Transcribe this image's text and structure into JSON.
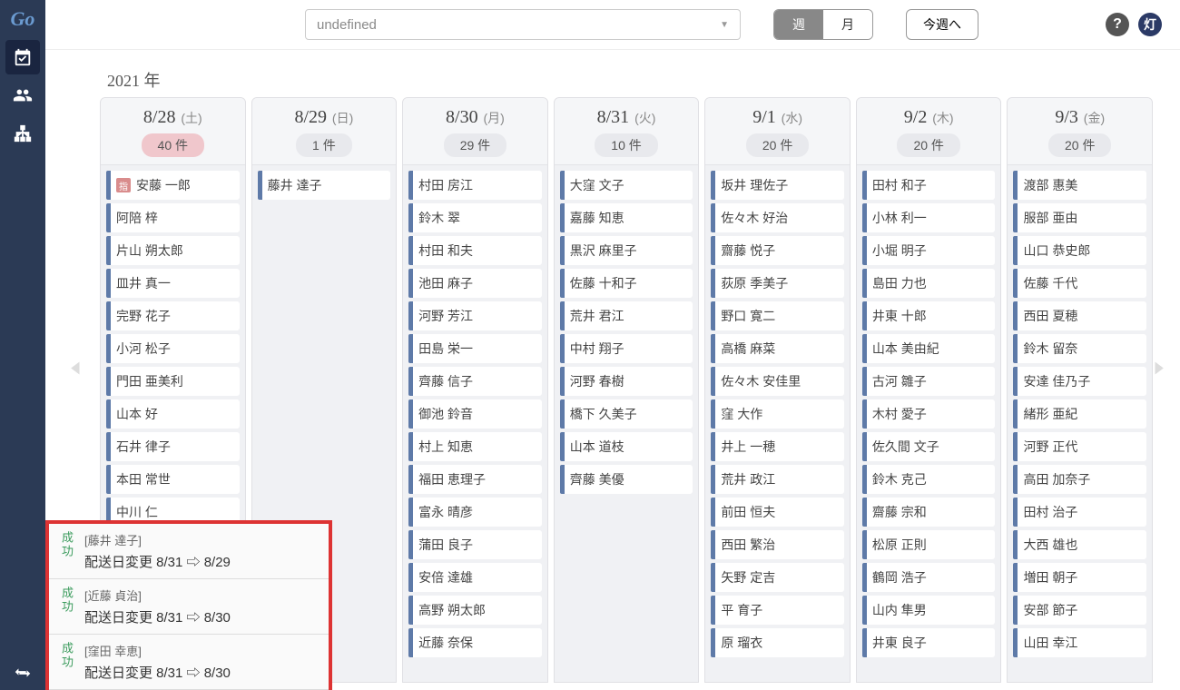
{
  "brand": {
    "logo": "Go",
    "circle": "灯"
  },
  "topbar": {
    "dropdown_value": "undefined",
    "toggle_week": "週",
    "toggle_month": "月",
    "today_btn": "今週へ",
    "help": "?"
  },
  "year_label": "2021 年",
  "days": [
    {
      "date": "8/28",
      "dow": "(土)",
      "count": "40 件",
      "highlight": true,
      "entries": [
        {
          "name": "安藤 一郎",
          "badge": "指"
        },
        {
          "name": "阿陪 梓"
        },
        {
          "name": "片山 朔太郎"
        },
        {
          "name": "皿井 真一"
        },
        {
          "name": "完野 花子"
        },
        {
          "name": "小河 松子"
        },
        {
          "name": "門田 亜美利"
        },
        {
          "name": "山本 好"
        },
        {
          "name": "石井 律子"
        },
        {
          "name": "本田 常世"
        },
        {
          "name": "中川 仁"
        }
      ]
    },
    {
      "date": "8/29",
      "dow": "(日)",
      "count": "1 件",
      "entries": [
        {
          "name": "藤井 達子"
        }
      ]
    },
    {
      "date": "8/30",
      "dow": "(月)",
      "count": "29 件",
      "entries": [
        {
          "name": "村田 房江"
        },
        {
          "name": "鈴木 翠"
        },
        {
          "name": "村田 和夫"
        },
        {
          "name": "池田 麻子"
        },
        {
          "name": "河野 芳江"
        },
        {
          "name": "田島 栄一"
        },
        {
          "name": "齊藤 信子"
        },
        {
          "name": "御池 鈴音"
        },
        {
          "name": "村上 知恵"
        },
        {
          "name": "福田 恵理子"
        },
        {
          "name": "富永 晴彦"
        },
        {
          "name": "蒲田 良子"
        },
        {
          "name": "安倍 達雄"
        },
        {
          "name": "高野 朔太郎"
        },
        {
          "name": "近藤 奈保"
        }
      ]
    },
    {
      "date": "8/31",
      "dow": "(火)",
      "count": "10 件",
      "entries": [
        {
          "name": "大窪 文子"
        },
        {
          "name": "嘉藤 知恵"
        },
        {
          "name": "黒沢 麻里子"
        },
        {
          "name": "佐藤 十和子"
        },
        {
          "name": "荒井 君江"
        },
        {
          "name": "中村 翔子"
        },
        {
          "name": "河野 春樹"
        },
        {
          "name": "橋下 久美子"
        },
        {
          "name": "山本 道枝"
        },
        {
          "name": "齊藤 美優"
        }
      ]
    },
    {
      "date": "9/1",
      "dow": "(水)",
      "count": "20 件",
      "entries": [
        {
          "name": "坂井 理佐子"
        },
        {
          "name": "佐々木 好治"
        },
        {
          "name": "齋藤 悦子"
        },
        {
          "name": "荻原 季美子"
        },
        {
          "name": "野口 寛二"
        },
        {
          "name": "高橋 麻菜"
        },
        {
          "name": "佐々木 安佳里"
        },
        {
          "name": "窪 大作"
        },
        {
          "name": "井上 一穂"
        },
        {
          "name": "荒井 政江"
        },
        {
          "name": "前田 恒夫"
        },
        {
          "name": "西田 繁治"
        },
        {
          "name": "矢野 定吉"
        },
        {
          "name": "平 育子"
        },
        {
          "name": "原 瑠衣"
        }
      ]
    },
    {
      "date": "9/2",
      "dow": "(木)",
      "count": "20 件",
      "entries": [
        {
          "name": "田村 和子"
        },
        {
          "name": "小林 利一"
        },
        {
          "name": "小堀 明子"
        },
        {
          "name": "島田 力也"
        },
        {
          "name": "井東 十郎"
        },
        {
          "name": "山本 美由紀"
        },
        {
          "name": "古河 雛子"
        },
        {
          "name": "木村 愛子"
        },
        {
          "name": "佐久間 文子"
        },
        {
          "name": "鈴木 克己"
        },
        {
          "name": "齋藤 宗和"
        },
        {
          "name": "松原 正則"
        },
        {
          "name": "鶴岡 浩子"
        },
        {
          "name": "山内 隼男"
        },
        {
          "name": "井東 良子"
        }
      ]
    },
    {
      "date": "9/3",
      "dow": "(金)",
      "count": "20 件",
      "entries": [
        {
          "name": "渡部 惠美"
        },
        {
          "name": "服部 亜由"
        },
        {
          "name": "山口 恭史郎"
        },
        {
          "name": "佐藤 千代"
        },
        {
          "name": "西田 夏穂"
        },
        {
          "name": "鈴木 留奈"
        },
        {
          "name": "安達 佳乃子"
        },
        {
          "name": "緒形 亜紀"
        },
        {
          "name": "河野 正代"
        },
        {
          "name": "高田 加奈子"
        },
        {
          "name": "田村 治子"
        },
        {
          "name": "大西 雄也"
        },
        {
          "name": "増田 朝子"
        },
        {
          "name": "安部 節子"
        },
        {
          "name": "山田 幸江"
        }
      ]
    }
  ],
  "toasts": [
    {
      "status": "成功",
      "name": "[藤井 達子]",
      "msg": "配送日変更   8/31 ⇨ 8/29"
    },
    {
      "status": "成功",
      "name": "[近藤 貞治]",
      "msg": "配送日変更   8/31 ⇨ 8/30"
    },
    {
      "status": "成功",
      "name": "[窪田 幸恵]",
      "msg": "配送日変更   8/31 ⇨ 8/30"
    }
  ]
}
